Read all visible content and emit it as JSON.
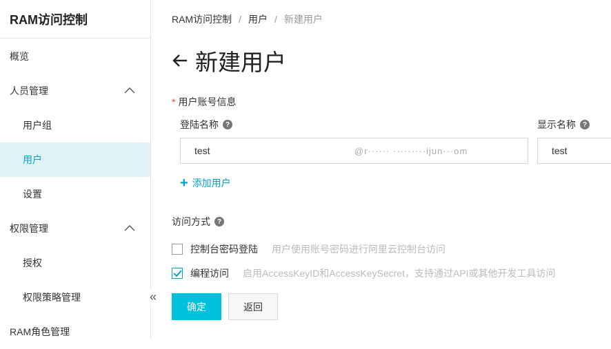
{
  "sidebar": {
    "title": "RAM访问控制",
    "items": [
      {
        "label": "概览"
      },
      {
        "label": "人员管理"
      },
      {
        "label": "用户组"
      },
      {
        "label": "用户"
      },
      {
        "label": "设置"
      },
      {
        "label": "权限管理"
      },
      {
        "label": "授权"
      },
      {
        "label": "权限策略管理"
      },
      {
        "label": "RAM角色管理"
      }
    ],
    "collapse_icon": "«"
  },
  "breadcrumb": [
    "RAM访问控制",
    "用户",
    "新建用户"
  ],
  "breadcrumb_sep": "/",
  "page_title": "新建用户",
  "account_section": {
    "required_mark": "*",
    "label": "用户账号信息"
  },
  "fields": {
    "login_name": {
      "label": "登陆名称",
      "value": "test",
      "suffix": "@r······ ·········ijun···om"
    },
    "display_name": {
      "label": "显示名称",
      "value": "test"
    },
    "help_icon": "?"
  },
  "add_user": {
    "icon": "+",
    "label": "添加用户"
  },
  "access": {
    "label": "访问方式",
    "options": [
      {
        "label": "控制台密码登陆",
        "desc": "用户使用账号密码进行阿里云控制台访问",
        "checked": false
      },
      {
        "label": "编程访问",
        "desc": "启用AccessKeyID和AccessKeySecret，支持通过API或其他开发工具访问",
        "checked": true
      }
    ]
  },
  "buttons": {
    "confirm": "确定",
    "back": "返回"
  },
  "colors": {
    "accent": "#00c1de",
    "link": "#00a2ca",
    "active_bg": "#dff3f9"
  }
}
